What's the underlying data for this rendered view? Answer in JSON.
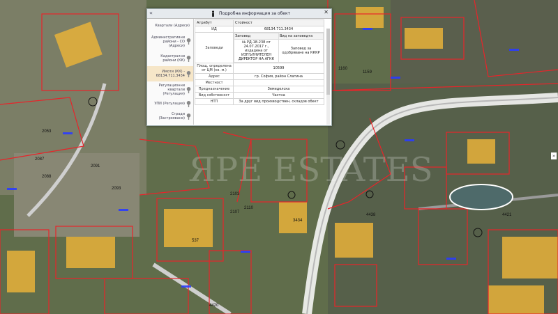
{
  "panel": {
    "title": "Подробна информация за обект",
    "collapse_glyph": "«",
    "close_glyph": "✕"
  },
  "sidebar": {
    "items": [
      {
        "label": "Квартали (Адреси)",
        "icon": "none"
      },
      {
        "label": "Административни райони - СО (Адреси)",
        "icon": "pin-icon"
      },
      {
        "label": "Кадастрални райони (КК)",
        "icon": "pin-icon"
      },
      {
        "label": "Имоти (КК) - 68134.711.3434",
        "icon": "pin-icon",
        "active": true
      },
      {
        "label": "Регулационни квартали (Регулация)",
        "icon": "pin-icon"
      },
      {
        "label": "УПИ (Регулация)",
        "icon": "pin-icon"
      },
      {
        "label": "Сгради (Застрояване)",
        "icon": "pin-icon"
      }
    ]
  },
  "table": {
    "col_attr": "Атрибут",
    "col_value": "Стойност",
    "rows": {
      "id": {
        "key": "ИД",
        "value": "68134.711.3434"
      },
      "orders": {
        "key": "Заповеди",
        "col_order": "Заповед",
        "col_type": "Вид на заповедта",
        "order": "№ РД-18-238 от 24.07.2017 г., издадена от ИЗПЪЛНИТЕЛЕН ДИРЕКТОР НА АГКК",
        "type": "Заповед за одобряване на КККР"
      },
      "area": {
        "key": "Площ, определена от ЦМ (кв. м.)",
        "value": "10599"
      },
      "address": {
        "key": "Адрес",
        "value": "гр. София, район Слатина"
      },
      "locality": {
        "key": "Местност",
        "value": ""
      },
      "purpose": {
        "key": "Предназначение",
        "value": "Земеделска"
      },
      "ownership": {
        "key": "Вид собственост",
        "value": "Частна"
      },
      "ntp": {
        "key": "НТП",
        "value": "За друг вид производствен, складов обект"
      }
    }
  },
  "map": {
    "watermark": "ЯРЕ ESTATES",
    "side_toggle": "»",
    "labels": [
      "2087",
      "2088",
      "2091",
      "2093",
      "2103",
      "2107",
      "2110",
      "3434",
      "4420",
      "4438",
      "537",
      "1160",
      "1159",
      "4421",
      "2053"
    ]
  },
  "colors": {
    "parcel": "#e8242a",
    "building": "#e8b13a",
    "road": "#ffffff",
    "annotation": "#2a3cff"
  }
}
